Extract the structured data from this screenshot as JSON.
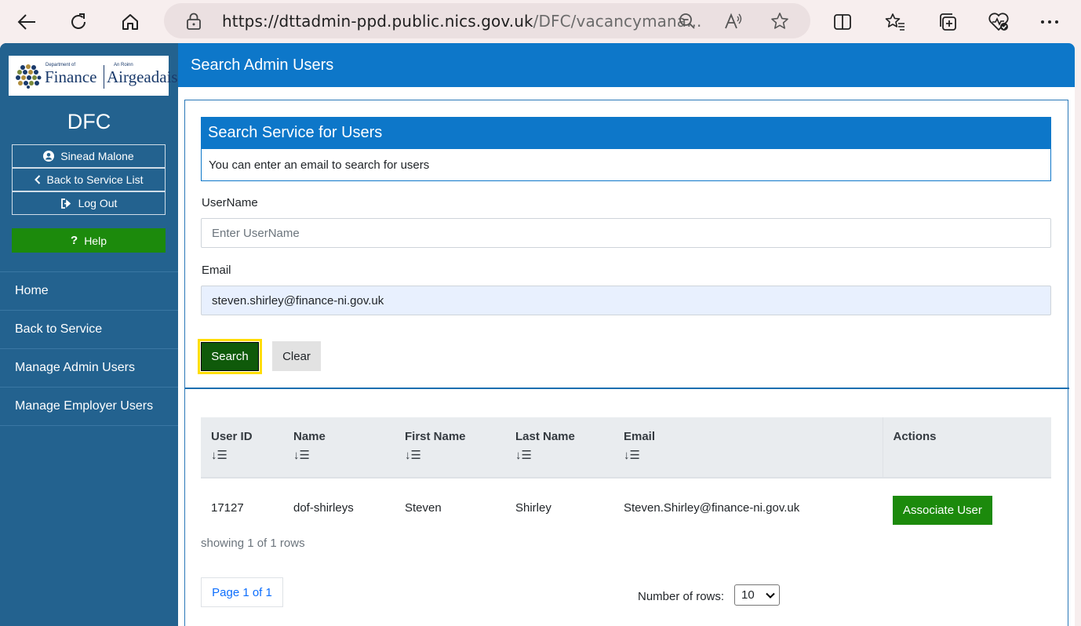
{
  "browser": {
    "url_main": "https://dttadmin-ppd.public.nics.gov.uk",
    "url_dim": "/DFC/vacancymana..."
  },
  "sidebar": {
    "logo_dept_small": "Department of",
    "logo_dept": "Finance",
    "logo_irish_small": "An Roinn",
    "logo_irish": "Airgeadais",
    "org": "DFC",
    "user_name": "Sinead Malone",
    "back_to_list": "Back to Service List",
    "logout": "Log Out",
    "help": "Help",
    "nav": [
      "Home",
      "Back to Service",
      "Manage Admin Users",
      "Manage Employer Users"
    ]
  },
  "main": {
    "header": "Search Admin Users",
    "panel_title": "Search Service for Users",
    "panel_body": "You can enter an email to search for users",
    "username_label": "UserName",
    "username_placeholder": "Enter UserName",
    "email_label": "Email",
    "email_value": "steven.shirley@finance-ni.gov.uk",
    "search_label": "Search",
    "clear_label": "Clear"
  },
  "table": {
    "headers": [
      "User ID",
      "Name",
      "First Name",
      "Last Name",
      "Email",
      "Actions"
    ],
    "rows": [
      [
        "17127",
        "dof-shirleys",
        "Steven",
        "Shirley",
        "Steven.Shirley@finance-ni.gov.uk"
      ]
    ],
    "action_label": "Associate User",
    "showing": "showing 1 of 1 rows",
    "page": "Page 1 of 1",
    "rows_label": "Number of rows:",
    "rows_value": "10"
  },
  "colors": {
    "header_blue": "#0d77c9",
    "sidebar_blue": "#23628f",
    "green": "#1c8a0c",
    "focus_yellow": "#ffdd00"
  }
}
